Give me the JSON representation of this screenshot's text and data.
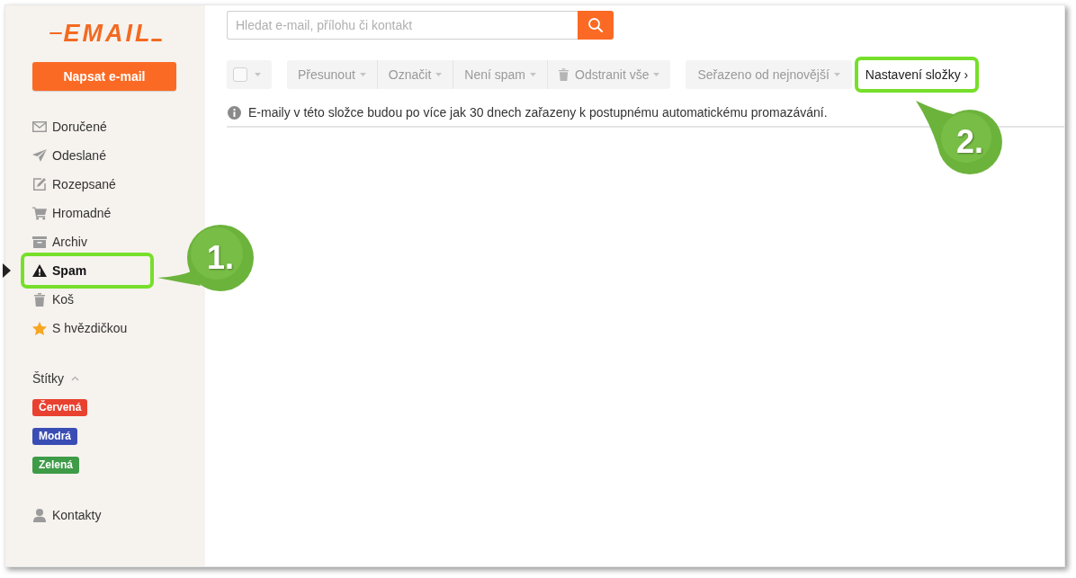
{
  "sidebar": {
    "logo": "EMAIL",
    "compose_button": "Napsat e-mail",
    "folders": [
      {
        "label": "Doručené",
        "selected": false,
        "highlighted": false
      },
      {
        "label": "Odeslané",
        "selected": false,
        "highlighted": false
      },
      {
        "label": "Rozepsané",
        "selected": false,
        "highlighted": false
      },
      {
        "label": "Hromadné",
        "selected": false,
        "highlighted": false
      },
      {
        "label": "Archiv",
        "selected": false,
        "highlighted": false
      },
      {
        "label": "Spam",
        "selected": true,
        "highlighted": true
      },
      {
        "label": "Koš",
        "selected": false,
        "highlighted": false
      },
      {
        "label": "S hvězdičkou",
        "selected": false,
        "highlighted": false
      }
    ],
    "labels": {
      "title": "Štítky",
      "expanded": true,
      "items": [
        {
          "text": "Červená",
          "color": "#e8412f"
        },
        {
          "text": "Modrá",
          "color": "#3a4db4"
        },
        {
          "text": "Zelená",
          "color": "#3e9b47"
        }
      ]
    },
    "contacts": "Kontakty"
  },
  "search": {
    "placeholder": "Hledat e-mail, přílohu či kontakt"
  },
  "toolbar": {
    "select_all": {
      "checked": false,
      "disabled": true
    },
    "actions": [
      {
        "label": "Přesunout",
        "disabled": true
      },
      {
        "label": "Označit",
        "disabled": true
      },
      {
        "label": "Není spam",
        "disabled": true
      }
    ],
    "delete_all": {
      "label": "Odstranit vše",
      "disabled": true
    },
    "sort": {
      "label": "Seřazeno od nejnovější",
      "disabled": true
    },
    "folder_settings": {
      "label": "Nastavení složky ›",
      "highlighted": true
    }
  },
  "notice": "E-maily v této složce budou po více jak 30 dnech zařazeny k postupnému automatickému promazávání.",
  "callouts": [
    {
      "number": "1."
    },
    {
      "number": "2."
    }
  ]
}
